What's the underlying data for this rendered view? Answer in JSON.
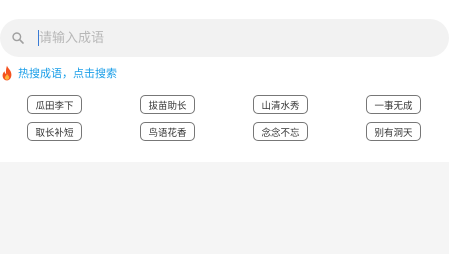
{
  "search": {
    "placeholder": "请输入成语",
    "value": ""
  },
  "hot": {
    "tip": "热搜成语，点击搜索",
    "tags": [
      "瓜田李下",
      "拔苗助长",
      "山清水秀",
      "一事无成",
      "取长补短",
      "鸟语花香",
      "念念不忘",
      "别有洞天"
    ]
  },
  "colors": {
    "accent": "#1a9ee8",
    "fire": "#f4511e",
    "search_bg": "#f2f2f2",
    "page_bg": "#f5f5f5"
  },
  "icons": {
    "search": "search-icon",
    "hot": "fire-icon"
  }
}
